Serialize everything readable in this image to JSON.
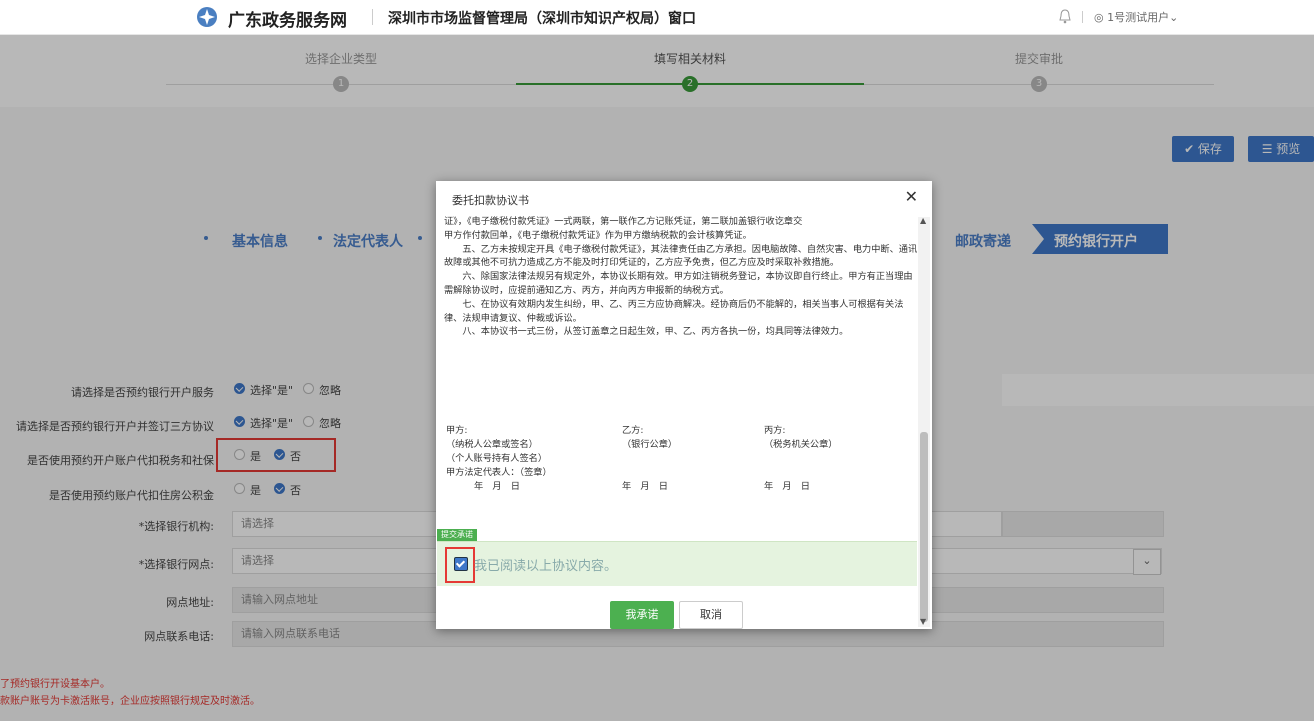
{
  "header": {
    "brand": "广东政务服务网",
    "window_title": "深圳市市场监督管理局（深圳市知识产权局）窗口",
    "user": "1号测试用户",
    "user_chevron": "⌄"
  },
  "steps": [
    {
      "label": "选择企业类型",
      "num": "1"
    },
    {
      "label": "填写相关材料",
      "num": "2"
    },
    {
      "label": "提交审批",
      "num": "3"
    }
  ],
  "toolbar": {
    "save": "✔ 保存",
    "preview": "☰ 预览"
  },
  "tabs": {
    "basic": "基本信息",
    "legal": "法定代表人",
    "postal": "邮政寄递",
    "active": "预约银行开户"
  },
  "form": {
    "q1": {
      "label": "请选择是否预约银行开户服务",
      "opt1": "选择\"是\"",
      "opt2": "忽略"
    },
    "q2": {
      "label": "请选择是否预约银行开户并签订三方协议",
      "opt1": "选择\"是\"",
      "opt2": "忽略"
    },
    "q3": {
      "label": "是否使用预约开户账户代扣税务和社保",
      "opt1": "是",
      "opt2": "否"
    },
    "q4": {
      "label": "是否使用预约账户代扣住房公积金",
      "opt1": "是",
      "opt2": "否"
    },
    "bank": {
      "label": "*选择银行机构:",
      "placeholder": "请选择"
    },
    "branch": {
      "label": "*选择银行网点:",
      "placeholder": "请选择"
    },
    "address": {
      "label": "网点地址:",
      "placeholder": "请输入网点地址"
    },
    "phone": {
      "label": "网点联系电话:",
      "placeholder": "请输入网点联系电话"
    }
  },
  "notes": [
    "了预约银行开设基本户。",
    "款账户账号为卡激活账号，企业应按照银行规定及时激活。"
  ],
  "modal": {
    "title": "委托扣款协议书",
    "close": "✕",
    "paragraphs": [
      "证》，《电子缴税付款凭证》一式两联，第一联作乙方记账凭证，第二联加盖银行收讫章交",
      "甲方作付款回单，《电子缴税付款凭证》作为甲方缴纳税款的会计核算凭证。",
      "五、乙方未按规定开具《电子缴税付款凭证》，其法律责任由乙方承担。因电脑故障、自然灾害、电力中断、通讯故障或其他不可抗力造成乙方不能及时打印凭证的，乙方应予免责，但乙方应及时采取补救措施。",
      "六、除国家法律法规另有规定外，本协议长期有效。甲方如注销税务登记，本协议即自行终止。甲方有正当理由需解除协议时，应提前通知乙方、丙方，并向丙方申报新的纳税方式。",
      "七、在协议有效期内发生纠纷，甲、乙、丙三方应协商解决。经协商后仍不能解的，相关当事人可根据有关法律、法规申请复议、仲裁或诉讼。",
      "八、本协议书一式三份，从签订盖章之日起生效，甲、乙、丙方各执一份，均具同等法律效力。"
    ],
    "party_a": [
      "甲方:",
      "（纳税人公章或签名）",
      "（个人账号持有人签名）",
      "甲方法定代表人：（签章）",
      "年　月　日"
    ],
    "party_b": [
      "乙方:",
      "（银行公章）",
      "年　月　日"
    ],
    "party_c": [
      "丙方:",
      "（税务机关公章）",
      "年　月　日"
    ],
    "commit_tag": "提交承诺",
    "commit_text": "我已阅读以上协议内容。",
    "ok": "我承诺",
    "cancel": "取消"
  }
}
